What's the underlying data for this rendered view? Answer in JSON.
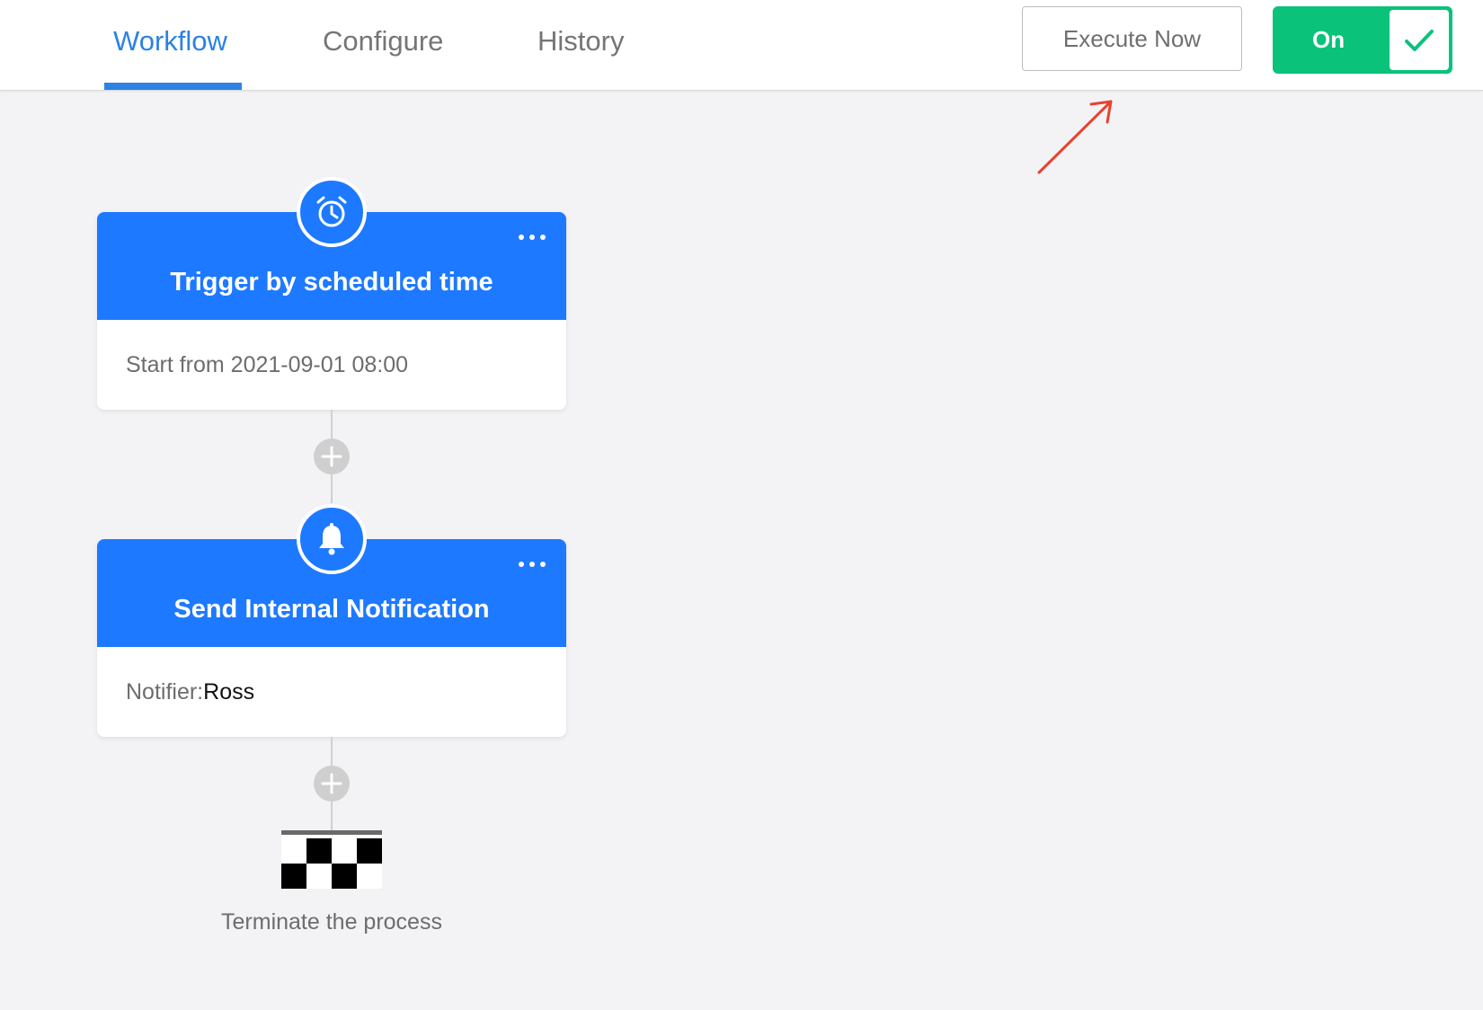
{
  "tabs": [
    {
      "label": "Workflow",
      "active": true
    },
    {
      "label": "Configure",
      "active": false
    },
    {
      "label": "History",
      "active": false
    }
  ],
  "actions": {
    "execute_label": "Execute Now",
    "toggle_label": "On",
    "toggle_on": true
  },
  "nodes": [
    {
      "title": "Trigger by scheduled time",
      "icon": "alarm-clock-icon",
      "detail_label": "Start from 2021-09-01 08:00",
      "detail_value": ""
    },
    {
      "title": "Send Internal Notification",
      "icon": "bell-icon",
      "detail_label": "Notifier:",
      "detail_value": "Ross"
    }
  ],
  "end": {
    "label": "Terminate the process",
    "icon": "checkered-flag-icon"
  },
  "colors": {
    "accent": "#2b82e4",
    "node_header": "#1d79ff",
    "toggle_green": "#0bc27a",
    "annotation_arrow": "#e8432e"
  }
}
